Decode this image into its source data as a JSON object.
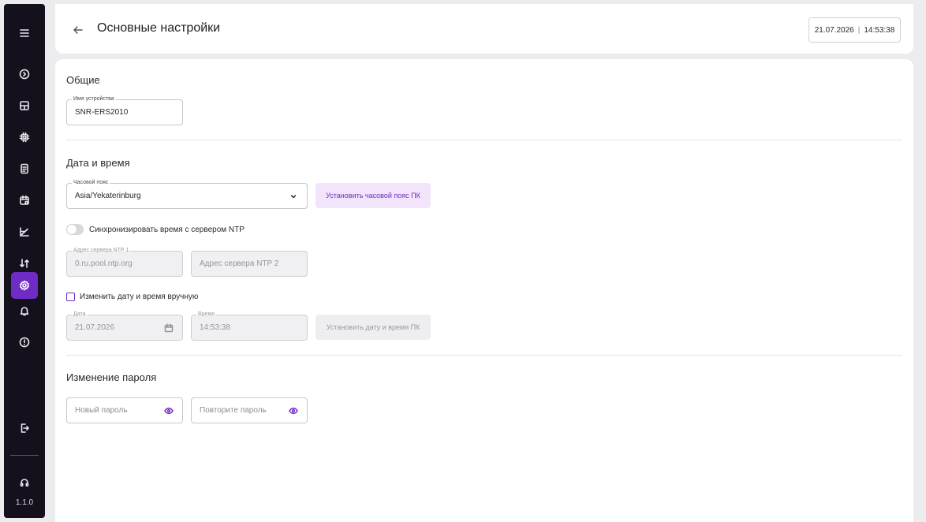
{
  "sidebar": {
    "version": "1.1.0"
  },
  "header": {
    "title": "Основные настройки",
    "date": "21.07.2026",
    "time": "14:53:38"
  },
  "general": {
    "title": "Общие",
    "device_name_label": "Имя устройства",
    "device_name_value": "SNR-ERS2010"
  },
  "datetime": {
    "title": "Дата и время",
    "timezone_label": "Часовой пояс",
    "timezone_value": "Asia/Yekaterinburg",
    "set_pc_timezone_button": "Установить часовой пояс ПК",
    "ntp_sync_label": "Синхронизировать время с сервером NTP",
    "ntp1_label": "Адрес сервера NTP 1",
    "ntp1_value": "0.ru.pool.ntp.org",
    "ntp2_placeholder": "Адрес сервера NTP 2",
    "manual_label": "Изменить дату и время вручную",
    "date_label": "Дата",
    "date_value": "21.07.2026",
    "time_label": "Время",
    "time_value": "14:53:38",
    "set_pc_datetime_button": "Установить дату и время ПК"
  },
  "password": {
    "title": "Изменение пароля",
    "new_placeholder": "Новый пароль",
    "repeat_placeholder": "Повторите пароль"
  },
  "colors": {
    "accent": "#6f2cc4",
    "sidebar_bg": "#14101c",
    "accent_soft": "#f2e4fb"
  }
}
